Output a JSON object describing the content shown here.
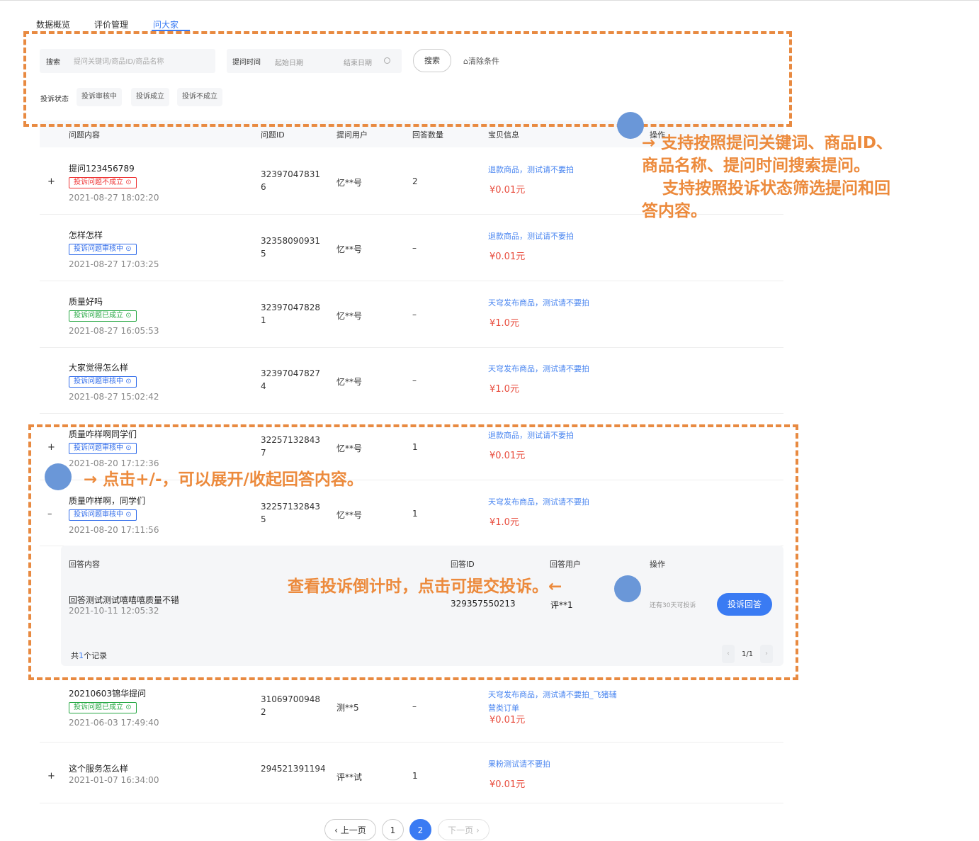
{
  "tabs": [
    "数据概览",
    "评价管理",
    "问大家"
  ],
  "filters": {
    "search_label": "搜索",
    "search_placeholder": "提问关键词/商品ID/商品名称",
    "date_label": "提问时间",
    "date_start": "起始日期",
    "date_end": "结束日期",
    "search_button": "搜索",
    "clear_label": "清除条件",
    "status_label": "投诉状态",
    "status_chips": [
      "投诉审核中",
      "投诉成立",
      "投诉不成立"
    ]
  },
  "table": {
    "headers": [
      "问题内容",
      "问题ID",
      "提问用户",
      "回答数量",
      "宝贝信息",
      "操作"
    ],
    "rows": [
      {
        "expander": "+",
        "title": "提问123456789",
        "badge": "投诉问题不成立",
        "badge_color": "red",
        "time": "2021-08-27 18:02:20",
        "id_line1": "32397047831",
        "id_line2": "6",
        "user": "忆**号",
        "count": "2",
        "goods_line1": "退款商品，测试请不要拍",
        "goods_line2": "",
        "price": "¥0.01元"
      },
      {
        "expander": "",
        "title": "怎样怎样",
        "badge": "投诉问题审核中",
        "badge_color": "blue",
        "time": "2021-08-27 17:03:25",
        "id_line1": "32358090931",
        "id_line2": "5",
        "user": "忆**号",
        "count": "–",
        "goods_line1": "退款商品，测试请不要拍",
        "goods_line2": "",
        "price": "¥0.01元"
      },
      {
        "expander": "",
        "title": "质量好吗",
        "badge": "投诉问题已成立",
        "badge_color": "green",
        "time": "2021-08-27 16:05:53",
        "id_line1": "32397047828",
        "id_line2": "1",
        "user": "忆**号",
        "count": "–",
        "goods_line1": "天穹发布商品，测试请不要拍",
        "goods_line2": "",
        "price": "¥1.0元"
      },
      {
        "expander": "",
        "title": "大家觉得怎么样",
        "badge": "投诉问题审核中",
        "badge_color": "blue",
        "time": "2021-08-27 15:02:42",
        "id_line1": "32397047827",
        "id_line2": "4",
        "user": "忆**号",
        "count": "–",
        "goods_line1": "天穹发布商品，测试请不要拍",
        "goods_line2": "",
        "price": "¥1.0元"
      },
      {
        "expander": "+",
        "title": "质量咋样啊同学们",
        "badge": "投诉问题审核中",
        "badge_color": "blue",
        "time": "2021-08-20 17:12:36",
        "id_line1": "32257132843",
        "id_line2": "7",
        "user": "忆**号",
        "count": "1",
        "goods_line1": "退款商品，测试请不要拍",
        "goods_line2": "",
        "price": "¥0.01元"
      },
      {
        "expander": "–",
        "title": "质量咋样啊，同学们",
        "badge": "投诉问题审核中",
        "badge_color": "blue",
        "time": "2021-08-20 17:11:56",
        "id_line1": "32257132843",
        "id_line2": "5",
        "user": "忆**号",
        "count": "1",
        "goods_line1": "天穹发布商品，测试请不要拍",
        "goods_line2": "",
        "price": "¥1.0元"
      },
      {
        "expander": "",
        "title": "20210603锦华提问",
        "badge": "投诉问题已成立",
        "badge_color": "green",
        "time": "2021-06-03 17:49:40",
        "id_line1": "31069700948",
        "id_line2": "2",
        "user": "测**5",
        "count": "–",
        "goods_line1": "天穹发布商品，测试请不要拍_飞猪辅",
        "goods_line2": "营类订单",
        "price": "¥0.01元"
      },
      {
        "expander": "+",
        "title": "这个服务怎么样",
        "badge": "",
        "badge_color": "",
        "time": "2021-01-07 16:34:00",
        "id_line1": "294521391194",
        "id_line2": "",
        "user": "评**试",
        "count": "1",
        "goods_line1": "果粉测试请不要拍",
        "goods_line2": "",
        "price": "¥0.01元"
      }
    ]
  },
  "answers": {
    "headers": [
      "回答内容",
      "回答ID",
      "回答用户",
      "操作"
    ],
    "items": [
      {
        "text": "回答测试测试嘻嘻嘻质量不错",
        "time": "2021-10-11 12:05:32",
        "id": "329357550213",
        "user": "评**1",
        "countdown": "还有30天可投诉",
        "action": "投诉回答"
      }
    ],
    "total_prefix": "共",
    "total_num": "1",
    "total_suffix": "个记录",
    "page": "1/1"
  },
  "pagination": {
    "prev": "上一页",
    "pages": [
      "1",
      "2"
    ],
    "next": "下一页",
    "current": "2"
  },
  "annotations": {
    "filter_note_line1": "→ 支持按照提问关键词、商品ID、",
    "filter_note_line2": "商品名称、提问时间搜索提问。",
    "filter_note_line3": "支持按照投诉状态筛选提问和回",
    "filter_note_line4": "答内容。",
    "expand_note": "→ 点击+/-，可以展开/收起回答内容。",
    "complain_note": "查看投诉倒计时，点击可提交投诉。←"
  },
  "colors": {
    "accent": "#3a7bf3",
    "annotation": "#ec8a3c",
    "price": "#e84c3d"
  }
}
